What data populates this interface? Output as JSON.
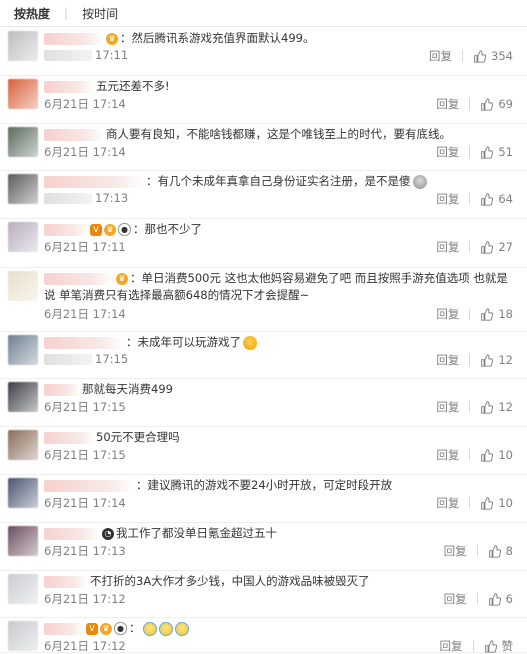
{
  "sort_tabs": [
    "按热度",
    "按时间"
  ],
  "actions": {
    "reply_label": "回复"
  },
  "comments": [
    {
      "name_hidden": true,
      "badges": [
        "vip"
      ],
      "text": "：然后腾讯系游戏充值界面默认499。",
      "time": "17:11",
      "likes": "354",
      "avatar_color": "#bdbdbd",
      "name_w": 60
    },
    {
      "name_hidden": true,
      "badges": [],
      "text": "五元还差不多!",
      "time": "6月21日 17:14",
      "likes": "69",
      "avatar_color": "#d9603b",
      "name_w": 50
    },
    {
      "name_hidden": true,
      "badges": [],
      "text": "商人要有良知，不能啥钱都赚，这是个唯钱至上的时代，要有底线。",
      "time": "6月21日 17:14",
      "likes": "51",
      "avatar_color": "#5a6b5e",
      "name_w": 60
    },
    {
      "name_hidden": true,
      "badges": [],
      "text": "：有几个未成年真拿自己身份证实名注册，是不是傻",
      "time": "17:13",
      "likes": "64",
      "avatar_color": "#5c5c5c",
      "name_w": 100,
      "emoji": "shock"
    },
    {
      "name_hidden": true,
      "badges": [
        "v",
        "vip",
        "panda"
      ],
      "text": "：那也不少了",
      "time": "6月21日 17:11",
      "likes": "27",
      "avatar_color": "#b8aebf",
      "name_w": 44
    },
    {
      "name_hidden": true,
      "badges": [
        "vip"
      ],
      "text": "：单日消费500元 这也太他妈容易避免了吧 而且按照手游充值选项 也就是说 单笔消费只有选择最高额648的情况下才会提醒~",
      "time": "6月21日 17:14",
      "likes": "18",
      "avatar_color": "#e8dfc9",
      "name_w": 70,
      "wrap": true
    },
    {
      "name_hidden": true,
      "badges": [],
      "text": "：未成年可以玩游戏了",
      "time": "17:15",
      "likes": "12",
      "avatar_color": "#6d7f92",
      "name_w": 80,
      "emoji": "laugh"
    },
    {
      "name_hidden": true,
      "badges": [],
      "text": "那就每天消费499",
      "time": "6月21日 17:15",
      "likes": "12",
      "avatar_color": "#3b3f45",
      "name_w": 36
    },
    {
      "name_hidden": true,
      "badges": [],
      "text": "50元不更合理吗",
      "time": "6月21日 17:15",
      "likes": "10",
      "avatar_color": "#8a6d5a",
      "name_w": 50
    },
    {
      "name_hidden": true,
      "badges": [],
      "text": "：建议腾讯的游戏不要24小时开放，可定时段开放",
      "time": "6月21日 17:14",
      "likes": "10",
      "avatar_color": "#4a5570",
      "name_w": 90
    },
    {
      "name_hidden": true,
      "badges": [
        "ring"
      ],
      "text": "我工作了都没单日氪金超过五十",
      "time": "6月21日 17:13",
      "likes": "8",
      "avatar_color": "#6b4e5e",
      "name_w": 56
    },
    {
      "name_hidden": true,
      "badges": [],
      "text": "不打折的3A大作才多少钱，中国人的游戏品味被毁灭了",
      "time": "6月21日 17:12",
      "likes": "6",
      "avatar_color": "#c9cdd1",
      "name_w": 44
    },
    {
      "name_hidden": true,
      "badges": [
        "v",
        "vip",
        "panda"
      ],
      "text": "：",
      "time": "6月21日 17:12",
      "likes": "赞",
      "avatar_color": "#c7c9cc",
      "name_w": 40,
      "emoji_row": 3
    }
  ],
  "colors": {
    "text": "#333333",
    "meta": "#808080",
    "divider": "#efefef"
  }
}
